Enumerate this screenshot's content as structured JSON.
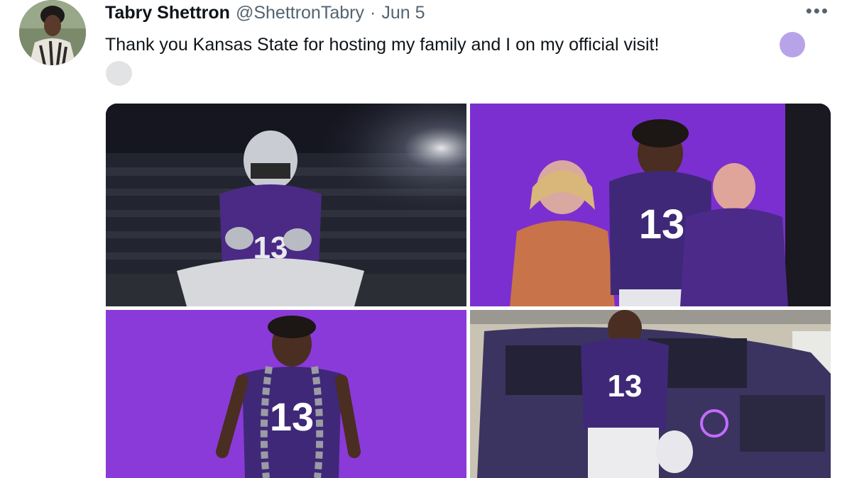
{
  "tweet": {
    "display_name": "Tabry Shettron",
    "handle": "@ShettronTabry",
    "separator": "·",
    "date": "Jun 5",
    "more_label": "•••",
    "text": "Thank you Kansas State for hosting my family and I on my official visit!",
    "emojis": [
      "purple-heart-emoji",
      "white-circle-emoji"
    ]
  },
  "media": {
    "photos": [
      {
        "jersey_number": "13"
      },
      {
        "jersey_number": "13"
      },
      {
        "jersey_number": "13"
      },
      {
        "jersey_number": "13"
      }
    ]
  },
  "colors": {
    "accent_purple": "#512888",
    "backdrop_purple": "#8b3bd9",
    "text_secondary": "#536471"
  }
}
